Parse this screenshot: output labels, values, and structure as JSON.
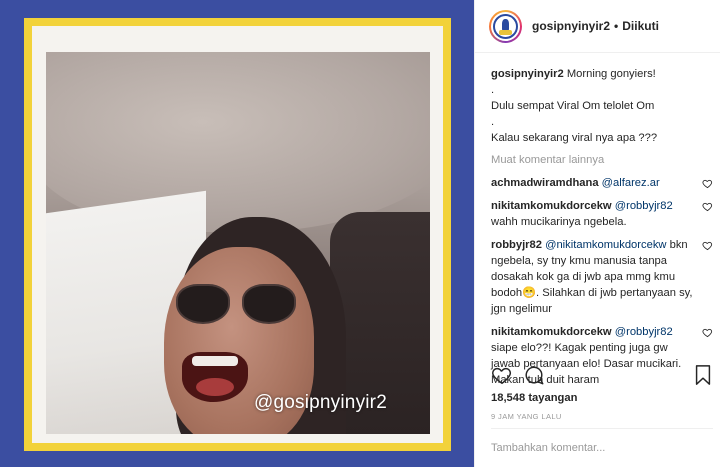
{
  "post": {
    "watermark": "@gosipnyinyir2"
  },
  "header": {
    "username": "gosipnyinyir2",
    "separator": "•",
    "follow_status": "Diikuti"
  },
  "caption": {
    "username": "gosipnyinyir2",
    "lines": [
      "Morning gonyiers!",
      ".",
      "Dulu sempat Viral Om telolet Om",
      ".",
      "Kalau sekarang viral nya apa ???"
    ]
  },
  "load_more": "Muat komentar lainnya",
  "comments": [
    {
      "username": "achmadwiramdhana",
      "mention": "@alfarez.ar",
      "text": ""
    },
    {
      "username": "nikitamkomukdorcekw",
      "mention": "@robbyjr82",
      "text": "wahh mucikarinya ngebela."
    },
    {
      "username": "robbyjr82",
      "mention": "@nikitamkomukdorcekw",
      "text": "bkn ngebela, sy tny kmu manusia tanpa dosakah kok ga di jwb apa mmg kmu bodoh😁. Silahkan di jwb pertanyaan sy, jgn ngelimur"
    },
    {
      "username": "nikitamkomukdorcekw",
      "mention": "@robbyjr82",
      "text": "siape elo??! Kagak penting juga gw jawab pertanyaan elo! Dasar mucikari. Makan tuh duit haram"
    }
  ],
  "stats": {
    "views_count": "18,548",
    "views_label": "tayangan",
    "time_ago": "9 JAM YANG LALU"
  },
  "composer": {
    "placeholder": "Tambahkan komentar..."
  },
  "icons": {
    "like": "heart-icon",
    "comment": "comment-icon",
    "save": "bookmark-icon",
    "comment_like": "heart-icon"
  },
  "colors": {
    "frame_outer": "#3b4ea1",
    "frame_inner": "#f2d23a",
    "mention": "#003569",
    "muted": "#999999"
  }
}
